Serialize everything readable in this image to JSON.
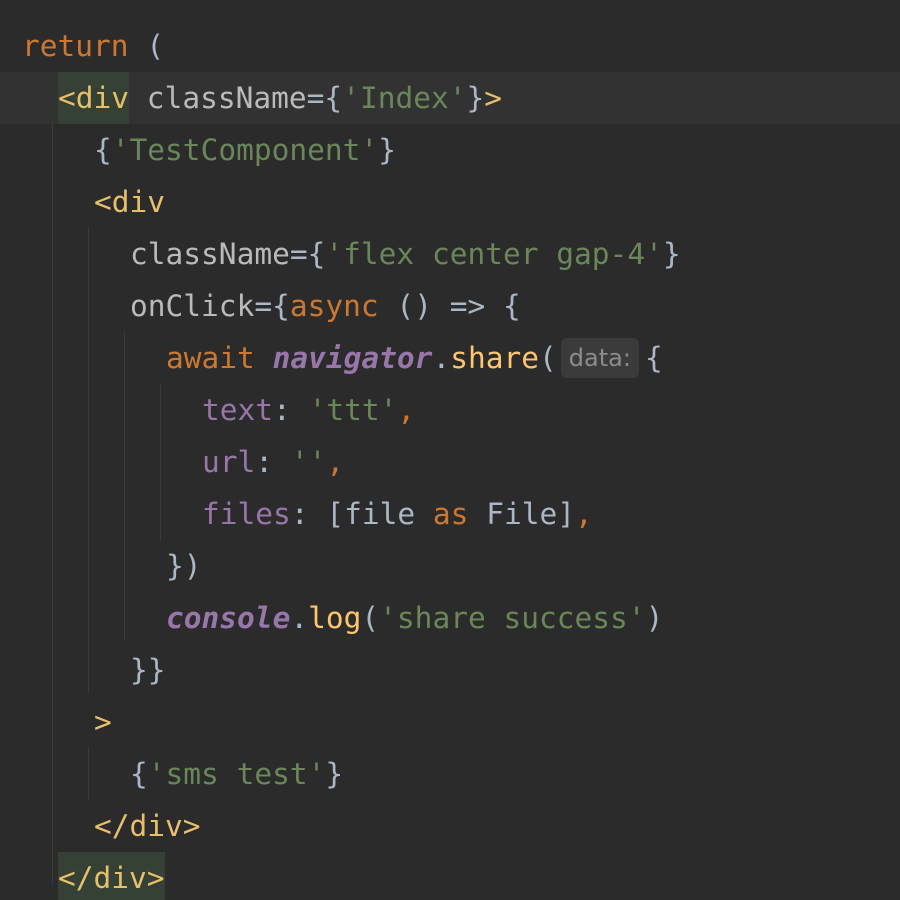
{
  "colors": {
    "background": "#2b2b2b",
    "caret_line": "#323232",
    "tag_match_highlight": "#344134",
    "keyword": "#cc7832",
    "tag": "#e8bf6a",
    "attribute": "#bababa",
    "string": "#6a8759",
    "punctuation": "#a9b7c6",
    "property": "#9876aa",
    "function": "#ffc66d"
  },
  "editor": {
    "lines": [
      {
        "t": [
          {
            "c": "kw",
            "v": "return"
          },
          {
            "c": "plain",
            "v": " ("
          }
        ]
      },
      {
        "t": [
          {
            "c": "tag hl",
            "v": "<div"
          },
          {
            "c": "attr",
            "v": " className"
          },
          {
            "c": "punc",
            "v": "={"
          },
          {
            "c": "str",
            "v": "'Index'"
          },
          {
            "c": "punc",
            "v": "}"
          },
          {
            "c": "tag",
            "v": ">"
          }
        ]
      },
      {
        "t": [
          {
            "c": "punc",
            "v": "{"
          },
          {
            "c": "str",
            "v": "'TestComponent'"
          },
          {
            "c": "punc",
            "v": "}"
          }
        ]
      },
      {
        "t": [
          {
            "c": "tag",
            "v": "<div"
          }
        ]
      },
      {
        "t": [
          {
            "c": "attr",
            "v": "className"
          },
          {
            "c": "punc",
            "v": "={"
          },
          {
            "c": "str",
            "v": "'flex center gap-4'"
          },
          {
            "c": "punc",
            "v": "}"
          }
        ]
      },
      {
        "t": [
          {
            "c": "attr",
            "v": "onClick"
          },
          {
            "c": "punc",
            "v": "={"
          },
          {
            "c": "kw",
            "v": "async"
          },
          {
            "c": "plain",
            "v": " () => {"
          }
        ]
      },
      {
        "t": [
          {
            "c": "kw",
            "v": "await "
          },
          {
            "c": "glob",
            "v": "navigator"
          },
          {
            "c": "plain",
            "v": "."
          },
          {
            "c": "fn",
            "v": "share"
          },
          {
            "c": "plain",
            "v": "("
          },
          {
            "c": "hint",
            "v": "data:"
          },
          {
            "c": "plain",
            "v": "{"
          }
        ]
      },
      {
        "t": [
          {
            "c": "prop",
            "v": "text"
          },
          {
            "c": "plain",
            "v": ": "
          },
          {
            "c": "str",
            "v": "'ttt'"
          },
          {
            "c": "kw",
            "v": ","
          }
        ]
      },
      {
        "t": [
          {
            "c": "prop",
            "v": "url"
          },
          {
            "c": "plain",
            "v": ": "
          },
          {
            "c": "str",
            "v": "''"
          },
          {
            "c": "kw",
            "v": ","
          }
        ]
      },
      {
        "t": [
          {
            "c": "prop",
            "v": "files"
          },
          {
            "c": "plain",
            "v": ": [file "
          },
          {
            "c": "kw",
            "v": "as"
          },
          {
            "c": "plain",
            "v": " File]"
          },
          {
            "c": "kw",
            "v": ","
          }
        ]
      },
      {
        "t": [
          {
            "c": "plain",
            "v": "})"
          }
        ]
      },
      {
        "t": [
          {
            "c": "glob",
            "v": "console"
          },
          {
            "c": "plain",
            "v": "."
          },
          {
            "c": "fn",
            "v": "log"
          },
          {
            "c": "plain",
            "v": "("
          },
          {
            "c": "str",
            "v": "'share success'"
          },
          {
            "c": "plain",
            "v": ")"
          }
        ]
      },
      {
        "t": [
          {
            "c": "plain",
            "v": "}}"
          }
        ]
      },
      {
        "t": [
          {
            "c": "tag",
            "v": ">"
          }
        ]
      },
      {
        "t": [
          {
            "c": "punc",
            "v": "{"
          },
          {
            "c": "str",
            "v": "'sms test'"
          },
          {
            "c": "punc",
            "v": "}"
          }
        ]
      },
      {
        "t": [
          {
            "c": "tag",
            "v": "</div>"
          }
        ]
      },
      {
        "t": [
          {
            "c": "tag hl",
            "v": "</div>"
          }
        ]
      }
    ]
  }
}
